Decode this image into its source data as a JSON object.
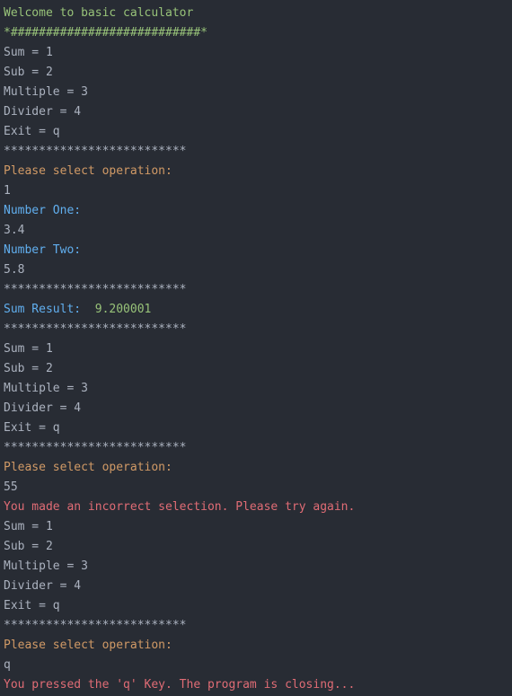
{
  "lines": [
    {
      "cls": "green",
      "text": "Welcome to basic calculator"
    },
    {
      "cls": "green",
      "text": "*###########################*"
    },
    {
      "cls": "gray",
      "text": "Sum = 1"
    },
    {
      "cls": "gray",
      "text": "Sub = 2"
    },
    {
      "cls": "gray",
      "text": "Multiple = 3"
    },
    {
      "cls": "gray",
      "text": "Divider = 4"
    },
    {
      "cls": "gray",
      "text": "Exit = q"
    },
    {
      "cls": "gray",
      "text": "**************************"
    },
    {
      "cls": "yellow",
      "text": "Please select operation:"
    },
    {
      "cls": "gray",
      "text": "1"
    },
    {
      "cls": "blue",
      "text": "Number One:"
    },
    {
      "cls": "gray",
      "text": "3.4"
    },
    {
      "cls": "blue",
      "text": "Number Two:"
    },
    {
      "cls": "gray",
      "text": "5.8"
    },
    {
      "cls": "gray",
      "text": "**************************"
    },
    {
      "cls": "mixed",
      "parts": [
        {
          "cls": "blue",
          "text": "Sum Result:"
        },
        {
          "cls": "green",
          "text": "  9.200001"
        }
      ]
    },
    {
      "cls": "gray",
      "text": "**************************"
    },
    {
      "cls": "gray",
      "text": "Sum = 1"
    },
    {
      "cls": "gray",
      "text": "Sub = 2"
    },
    {
      "cls": "gray",
      "text": "Multiple = 3"
    },
    {
      "cls": "gray",
      "text": "Divider = 4"
    },
    {
      "cls": "gray",
      "text": "Exit = q"
    },
    {
      "cls": "gray",
      "text": "**************************"
    },
    {
      "cls": "yellow",
      "text": "Please select operation:"
    },
    {
      "cls": "gray",
      "text": "55"
    },
    {
      "cls": "red",
      "text": "You made an incorrect selection. Please try again."
    },
    {
      "cls": "gray",
      "text": "Sum = 1"
    },
    {
      "cls": "gray",
      "text": "Sub = 2"
    },
    {
      "cls": "gray",
      "text": "Multiple = 3"
    },
    {
      "cls": "gray",
      "text": "Divider = 4"
    },
    {
      "cls": "gray",
      "text": "Exit = q"
    },
    {
      "cls": "gray",
      "text": "**************************"
    },
    {
      "cls": "yellow",
      "text": "Please select operation:"
    },
    {
      "cls": "gray",
      "text": "q"
    },
    {
      "cls": "red",
      "text": "You pressed the 'q' Key. The program is closing..."
    }
  ]
}
